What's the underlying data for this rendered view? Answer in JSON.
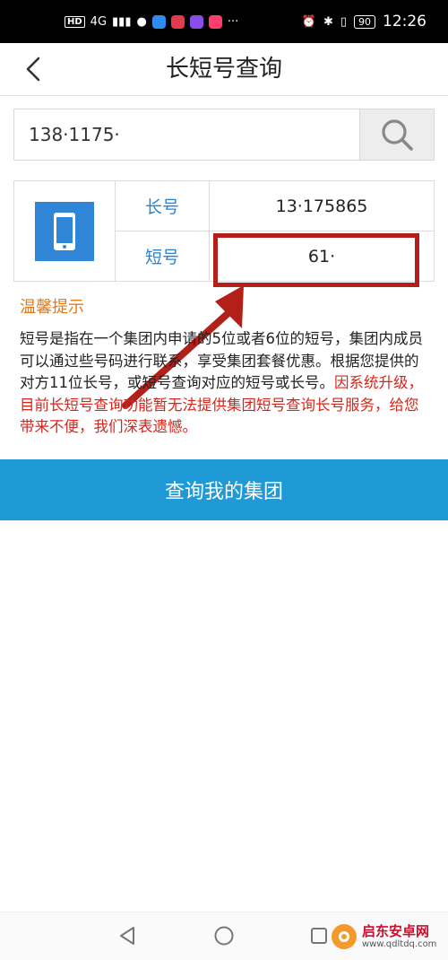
{
  "status_bar": {
    "hd": "HD",
    "network": "4G",
    "battery": "90",
    "time": "12:26",
    "app_colors": [
      "#2d8cf0",
      "#e4384d",
      "#8a4de8",
      "#ff3e6c"
    ]
  },
  "header": {
    "title": "长短号查询",
    "back_icon": "chevron-left-icon"
  },
  "search": {
    "value": "138·1175·",
    "icon": "search-icon"
  },
  "result": {
    "icon": "smartphone-icon",
    "rows": [
      {
        "label": "长号",
        "value": "13·175865"
      },
      {
        "label": "短号",
        "value": "61·"
      }
    ]
  },
  "tip": {
    "title": "温馨提示",
    "text": "短号是指在一个集团内申请的5位或者6位的短号，集团内成员可以通过些号码进行联系，享受集团套餐优惠。根据您提供的对方11位长号，或短号查询对应的短号或长号。",
    "notice": "因系统升级，目前长短号查询功能暂无法提供集团短号查询长号服务，给您带来不便，我们深表遗憾。"
  },
  "primary_button": {
    "label": "查询我的集团"
  },
  "nav_bar": {
    "back_icon": "triangle-back-icon",
    "home_icon": "circle-home-icon",
    "recents_icon": "square-recents-icon"
  },
  "watermark": {
    "name": "启东安卓网",
    "url": "www.qdltdq.com"
  },
  "colors": {
    "accent_blue": "#1f9ad6",
    "label_blue": "#2a83d0",
    "tip_orange": "#e07b1c",
    "notice_red": "#d6261c",
    "annotation_red": "#b32019"
  }
}
